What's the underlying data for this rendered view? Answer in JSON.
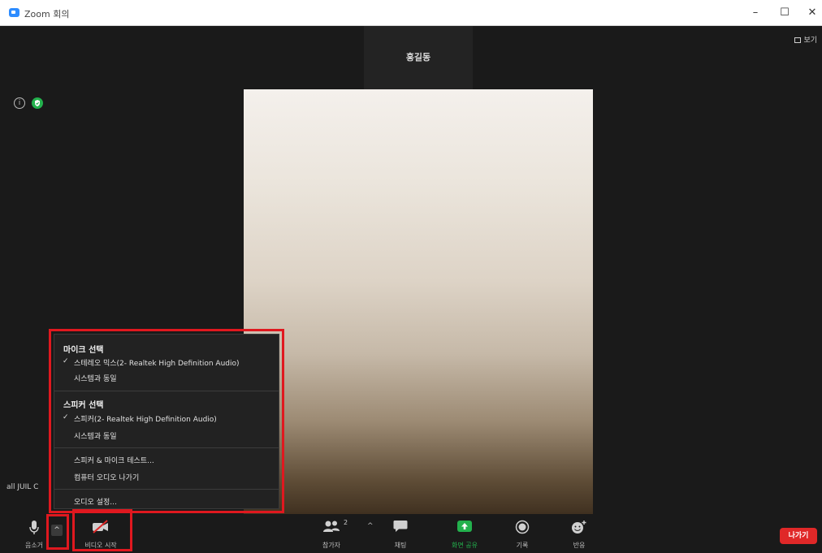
{
  "window": {
    "title": "Zoom 회의",
    "minimize": "–",
    "maximize": "☐",
    "close": "✕"
  },
  "stage": {
    "participant_name": "홍길동",
    "view_label": "보기",
    "info_glyph": "i",
    "signal_text": "all JUIL C"
  },
  "audio_menu": {
    "mic_title": "마이크 선택",
    "mic_options": [
      {
        "label": "스테레오 믹스(2- Realtek High Definition Audio)",
        "checked": true
      },
      {
        "label": "시스템과 동일",
        "checked": false
      }
    ],
    "speaker_title": "스피커 선택",
    "speaker_options": [
      {
        "label": "스피커(2- Realtek High Definition Audio)",
        "checked": true
      },
      {
        "label": "시스템과 동일",
        "checked": false
      }
    ],
    "check_glyph": "✓",
    "test_label": "스피커 & 마이크 테스트...",
    "leave_audio_label": "컴퓨터 오디오 나가기",
    "settings_label": "오디오 설정..."
  },
  "toolbar": {
    "mute_label": "음소거",
    "caret": "^",
    "video_label": "비디오 시작",
    "participants_label": "참가자",
    "participants_count": "2",
    "chat_label": "채팅",
    "share_label": "화면 공유",
    "record_label": "기록",
    "reactions_label": "반응",
    "leave_label": "나가기"
  },
  "colors": {
    "highlight": "#e0181f",
    "share_green": "#23b14d",
    "leave_red": "#e02828"
  }
}
